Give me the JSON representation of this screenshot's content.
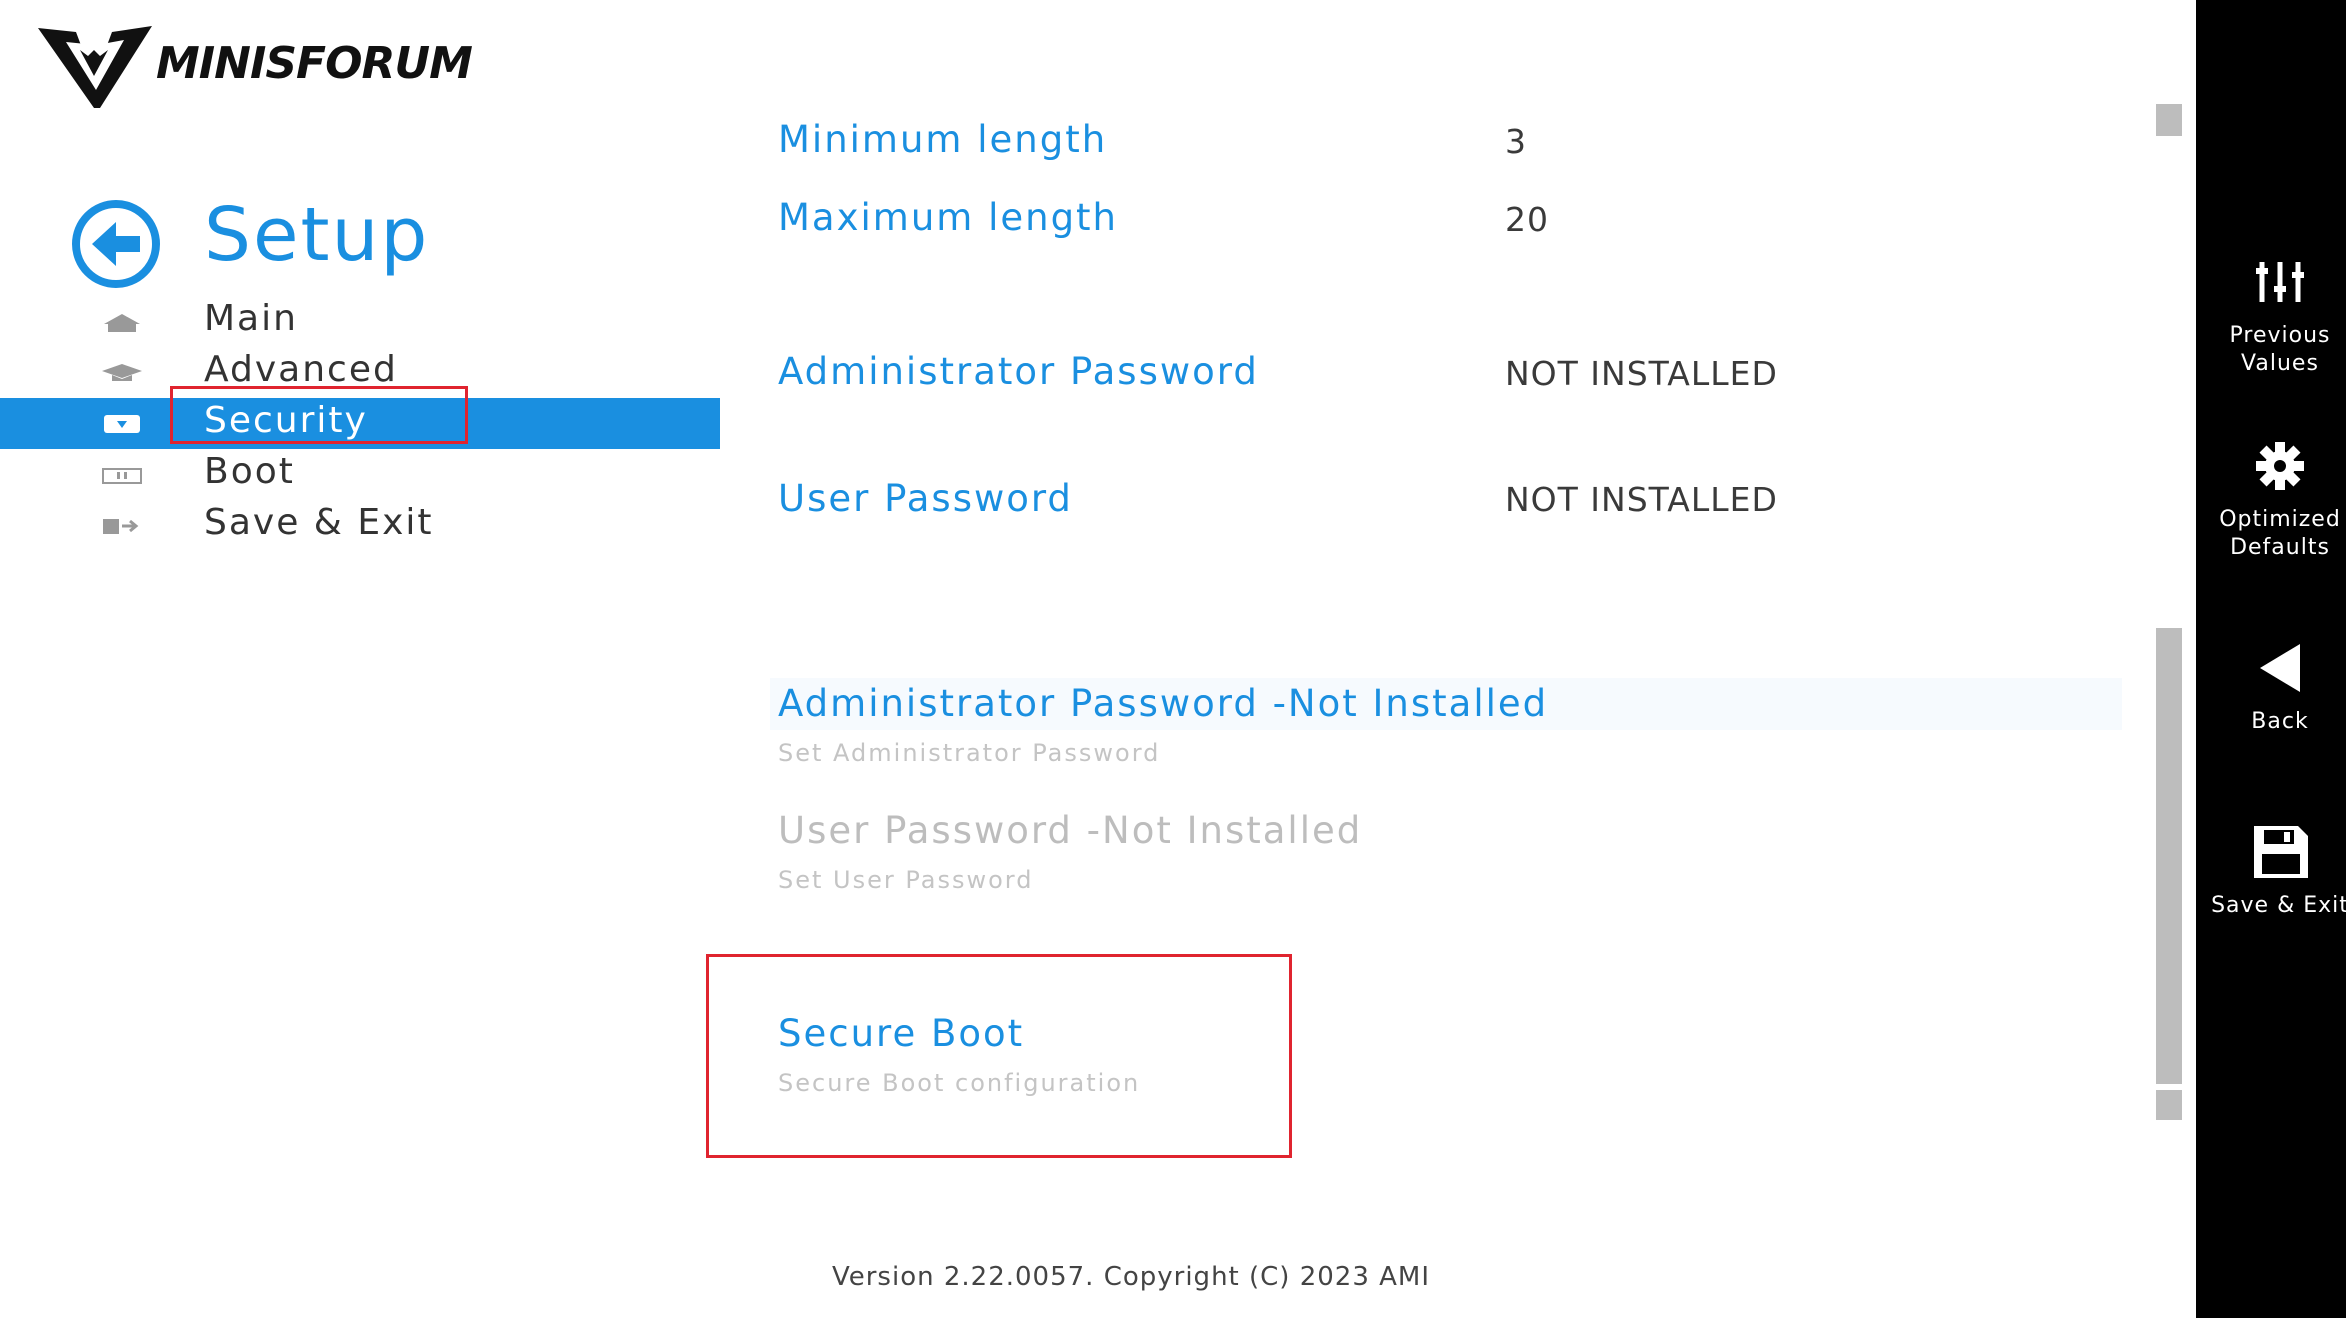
{
  "brand": {
    "logo_text": "MINISFORUM"
  },
  "nav": {
    "title": "Setup",
    "items": [
      {
        "label": "Main",
        "icon": "home-icon"
      },
      {
        "label": "Advanced",
        "icon": "graduation-cap-icon"
      },
      {
        "label": "Security",
        "icon": "shield-icon",
        "selected": true
      },
      {
        "label": "Boot",
        "icon": "drive-icon"
      },
      {
        "label": "Save & Exit",
        "icon": "exit-icon"
      }
    ]
  },
  "main": {
    "min_length": {
      "label": "Minimum length",
      "value": "3"
    },
    "max_length": {
      "label": "Maximum length",
      "value": "20"
    },
    "admin_password": {
      "label": "Administrator Password",
      "value": "NOT INSTALLED"
    },
    "user_password": {
      "label": "User Password",
      "value": "NOT INSTALLED"
    },
    "menu": [
      {
        "title": "Administrator Password -Not Installed",
        "desc": "Set Administrator Password",
        "state": "active"
      },
      {
        "title": "User Password -Not Installed",
        "desc": "Set User Password",
        "state": "disabled"
      },
      {
        "title": "Secure Boot",
        "desc": "Secure Boot configuration",
        "state": "active"
      }
    ]
  },
  "footer": {
    "text": "Version 2.22.0057. Copyright (C) 2023 AMI"
  },
  "side_panel": {
    "buttons": [
      {
        "label": "Previous\nValues",
        "icon": "sliders-icon"
      },
      {
        "label": "Optimized\nDefaults",
        "icon": "gear-icon"
      },
      {
        "label": "Back",
        "icon": "back-triangle-icon"
      },
      {
        "label": "Save & Exit",
        "icon": "floppy-disk-icon"
      }
    ]
  },
  "colors": {
    "accent": "#1a8fe0",
    "highlight_box": "#e0242f",
    "panel": "#000000"
  }
}
